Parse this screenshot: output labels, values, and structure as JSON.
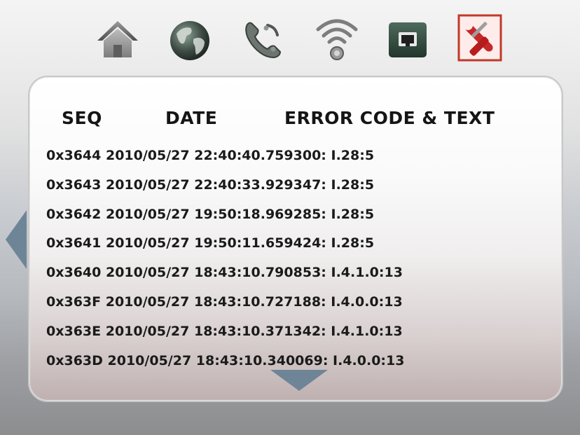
{
  "toolbar": {
    "icons": [
      "home-icon",
      "globe-icon",
      "phone-icon",
      "wifi-icon",
      "ethernet-icon",
      "tools-icon"
    ],
    "selected": "tools-icon"
  },
  "log": {
    "headers": {
      "seq": "SEQ",
      "date": "DATE",
      "error": "ERROR CODE & TEXT"
    },
    "rows": [
      "0x3644 2010/05/27 22:40:40.759300: I.28:5",
      "0x3643 2010/05/27 22:40:33.929347: I.28:5",
      "0x3642 2010/05/27 19:50:18.969285: I.28:5",
      "0x3641 2010/05/27 19:50:11.659424: I.28:5",
      "0x3640 2010/05/27 18:43:10.790853: I.4.1.0:13",
      "0x363F 2010/05/27 18:43:10.727188: I.4.0.0:13",
      "0x363E 2010/05/27 18:43:10.371342: I.4.1.0:13",
      "0x363D 2010/05/27 18:43:10.340069: I.4.0.0:13"
    ]
  },
  "colors": {
    "arrow": "#6e8597",
    "selected_border": "#c0392b",
    "ethernet_bg": "#2f4a3f"
  }
}
